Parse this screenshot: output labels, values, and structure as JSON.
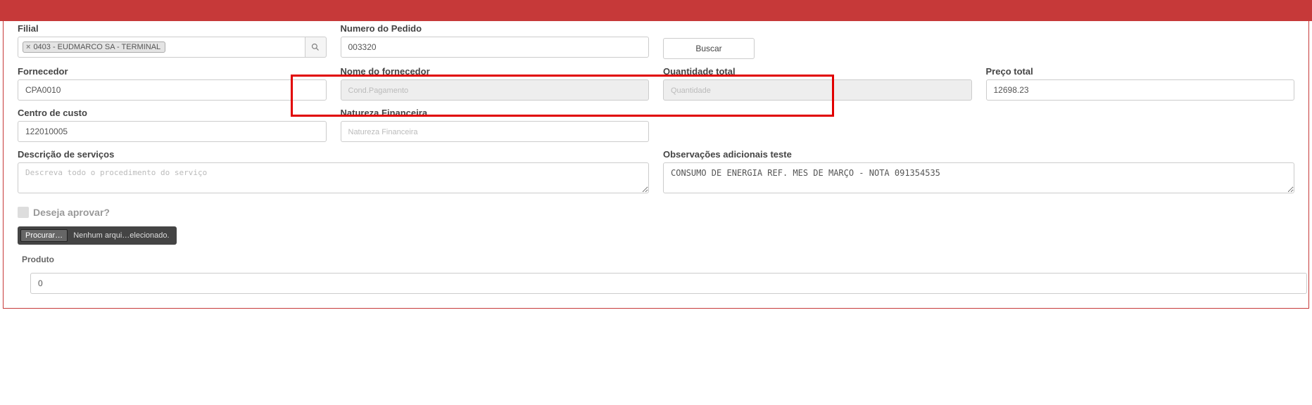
{
  "labels": {
    "filial": "Filial",
    "numero_pedido": "Numero do Pedido",
    "buscar": "Buscar",
    "fornecedor": "Fornecedor",
    "nome_fornecedor": "Nome do fornecedor",
    "quantidade_total": "Quantidade total",
    "preco_total": "Preço total",
    "centro_custo": "Centro de custo",
    "natureza_financeira": "Natureza Financeira",
    "descricao_servicos": "Descrição de serviços",
    "observacoes": "Observações adicionais teste",
    "deseja_aprovar": "Deseja aprovar?",
    "procurar": "Procurar…",
    "nenhum_arquivo": "Nenhum arqui…elecionado.",
    "produto": "Produto"
  },
  "values": {
    "filial_tag": "0403 - EUDMARCO SA - TERMINAL",
    "numero_pedido": "003320",
    "fornecedor": "CPA0010",
    "nome_fornecedor": "",
    "quantidade_total": "",
    "preco_total": "12698.23",
    "centro_custo": "122010005",
    "natureza_financeira": "",
    "descricao_servicos": "",
    "observacoes": "CONSUMO DE ENERGIA REF. MES DE MARÇO - NOTA 091354535",
    "produto": "0"
  },
  "placeholders": {
    "nome_fornecedor": "Cond.Pagamento",
    "quantidade_total": "Quantidade",
    "natureza_financeira": "Natureza Financeira",
    "descricao_servicos": "Descreva todo o procedimento do serviço"
  }
}
